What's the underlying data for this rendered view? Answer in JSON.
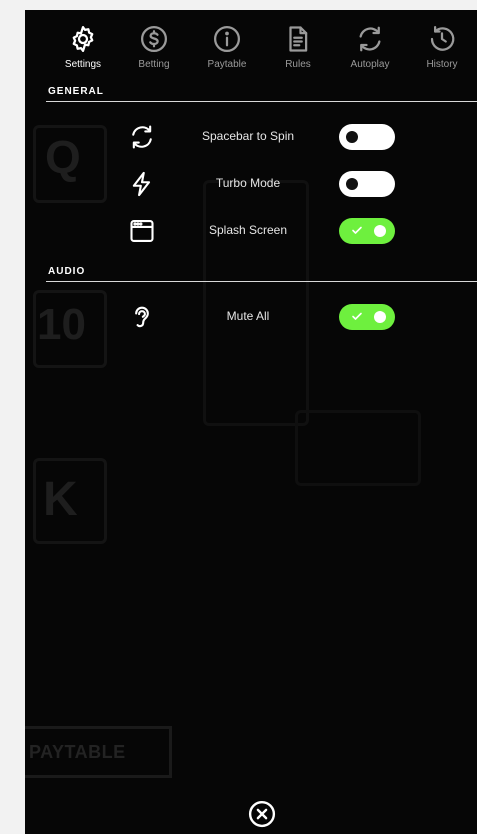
{
  "tabs": [
    {
      "label": "Settings",
      "icon": "gear-icon",
      "active": true
    },
    {
      "label": "Betting",
      "icon": "dollar-icon",
      "active": false
    },
    {
      "label": "Paytable",
      "icon": "info-icon",
      "active": false
    },
    {
      "label": "Rules",
      "icon": "document-icon",
      "active": false
    },
    {
      "label": "Autoplay",
      "icon": "refresh-icon",
      "active": false
    },
    {
      "label": "History",
      "icon": "history-icon",
      "active": false
    }
  ],
  "general": {
    "title": "GENERAL",
    "rows": [
      {
        "label": "Spacebar to Spin",
        "icon": "refresh-icon",
        "enabled": false
      },
      {
        "label": "Turbo Mode",
        "icon": "lightning-icon",
        "enabled": false
      },
      {
        "label": "Splash Screen",
        "icon": "window-icon",
        "enabled": true
      }
    ]
  },
  "audio": {
    "title": "AUDIO",
    "rows": [
      {
        "label": "Mute All",
        "icon": "ear-icon",
        "enabled": true
      }
    ]
  },
  "background": {
    "symbols": [
      "Q",
      "10",
      "K"
    ],
    "paytable_label": "PAYTABLE"
  },
  "colors": {
    "toggle_on": "#6ef03e",
    "toggle_off": "#ffffff",
    "active_tab": "#ffffff",
    "inactive_tab": "#9a9a9a",
    "panel": "#060606"
  },
  "close": {
    "icon": "close-circle-icon"
  }
}
